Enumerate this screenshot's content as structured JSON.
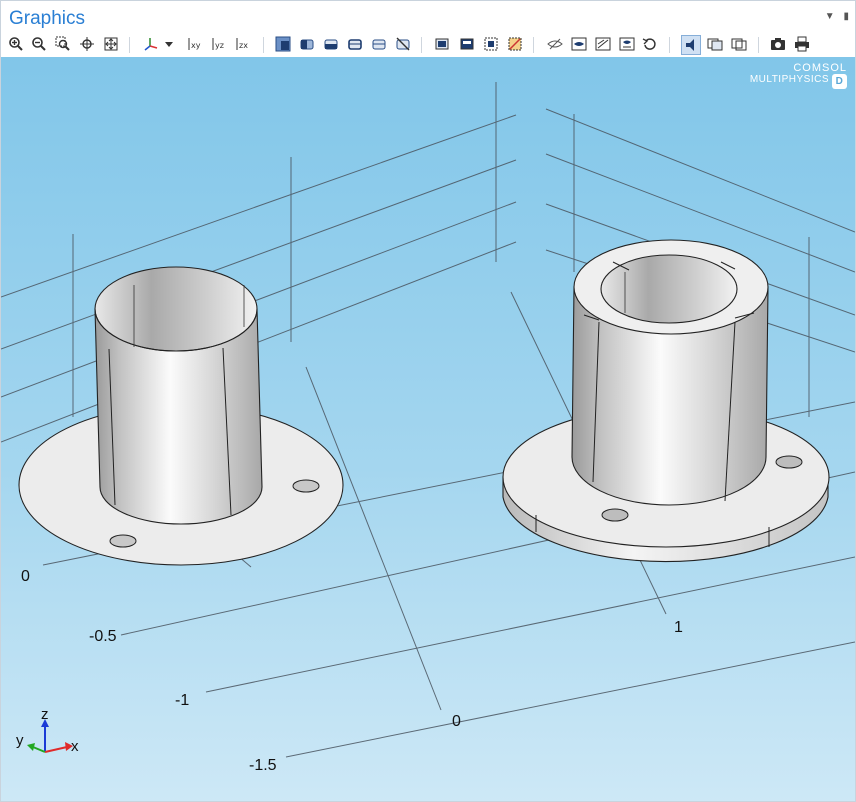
{
  "window": {
    "title": "Graphics"
  },
  "toolbar": {
    "buttons": [
      {
        "icon": "zoom-in-icon"
      },
      {
        "icon": "zoom-out-icon"
      },
      {
        "icon": "zoom-box-icon"
      },
      {
        "icon": "zoom-selected-icon"
      },
      {
        "icon": "zoom-extents-icon"
      },
      {
        "icon": "view-axes-icon"
      },
      {
        "icon": "dropdown-arrow-icon"
      },
      {
        "icon": "go-to-xy-view-icon",
        "label": "xy"
      },
      {
        "icon": "go-to-yz-view-icon",
        "label": "yz"
      },
      {
        "icon": "go-to-zx-view-icon",
        "label": "zx"
      },
      {
        "icon": "select-boxes-icon"
      },
      {
        "icon": "select-domains-icon"
      },
      {
        "icon": "select-boundaries-icon"
      },
      {
        "icon": "select-edges-icon"
      },
      {
        "icon": "select-points-icon"
      },
      {
        "icon": "clear-selection-icon"
      },
      {
        "icon": "build-all-icon"
      },
      {
        "icon": "build-selected-icon"
      },
      {
        "icon": "hide-selected-icon"
      },
      {
        "icon": "clear-hide-icon"
      },
      {
        "icon": "hide-show-icon"
      },
      {
        "icon": "view-show-icon"
      },
      {
        "icon": "wireframe-icon"
      },
      {
        "icon": "transparency-icon"
      },
      {
        "icon": "reset-view-icon"
      },
      {
        "icon": "scene-light-icon"
      },
      {
        "icon": "render-mode-icon"
      },
      {
        "icon": "grid-icon"
      },
      {
        "icon": "image-snapshot-icon"
      },
      {
        "icon": "print-icon"
      }
    ]
  },
  "viewport": {
    "logo": {
      "line1": "COMSOL",
      "line2": "MULTIPHYSICS",
      "badge": "D"
    },
    "axis_ticks": [
      "0",
      "-0.5",
      "-1",
      "-1.5",
      "0",
      "1"
    ],
    "triad": {
      "x": "x",
      "y": "y",
      "z": "z"
    }
  },
  "colors": {
    "title": "#2a7fd4",
    "background_top": "#81c6e9",
    "background_bottom": "#cde8f6",
    "grid_lines": "#4a5560",
    "geometry_fill": "#e6e6e6"
  }
}
